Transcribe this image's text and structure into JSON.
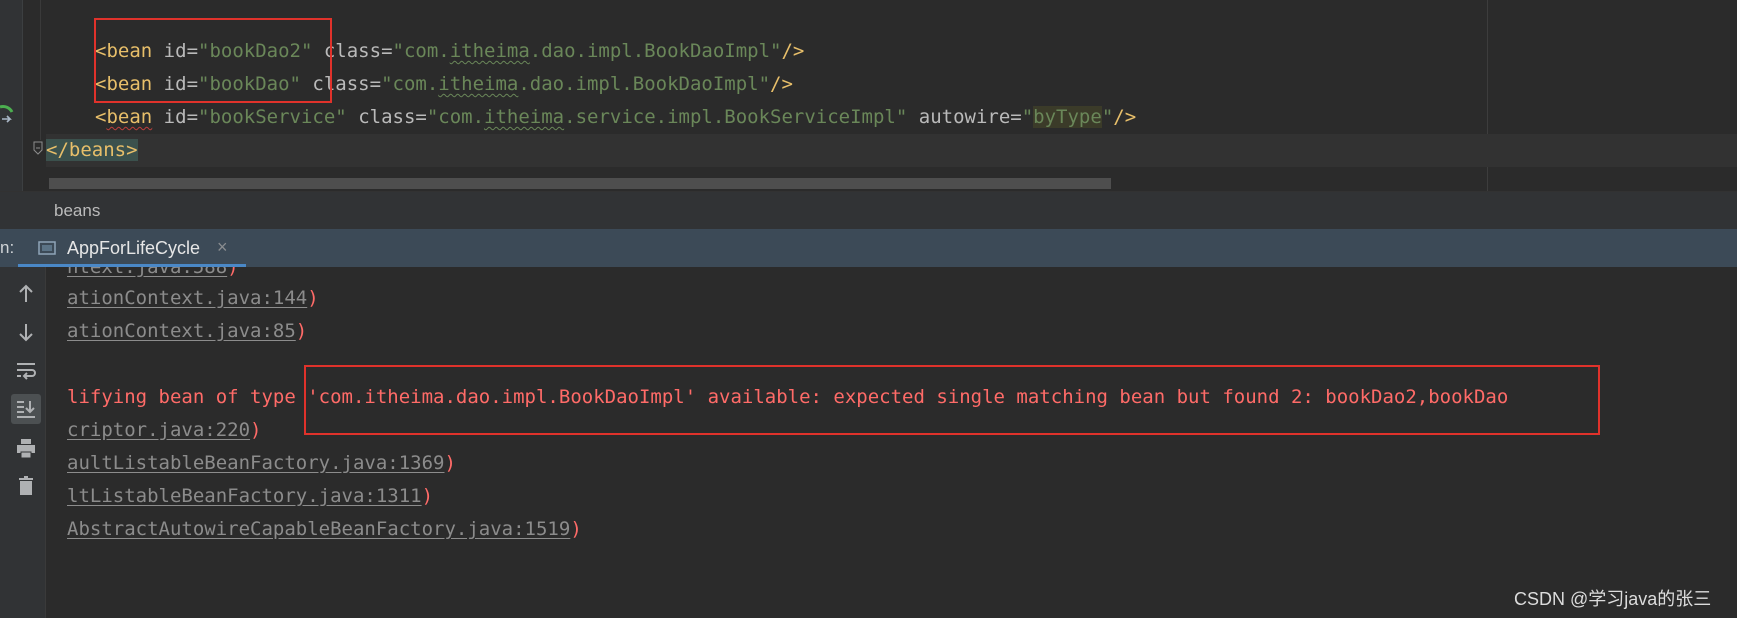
{
  "editor": {
    "lines": [
      {
        "open": "<",
        "tag": "bean",
        "sp1": " ",
        "attr1": "id",
        "eq1": "=",
        "val1": "\"bookDao2\"",
        "sp2": " ",
        "attr2": "class",
        "eq2": "=",
        "val2_a": "\"com.",
        "val2_b": "itheima",
        "val2_c": ".dao.impl.BookDaoImpl\"",
        "close": "/>"
      },
      {
        "open": "<",
        "tag": "bean",
        "sp1": " ",
        "attr1": "id",
        "eq1": "=",
        "val1": "\"bookDao\"",
        "sp2": " ",
        "attr2": "class",
        "eq2": "=",
        "val2_a": "\"com.",
        "val2_b": "itheima",
        "val2_c": ".dao.impl.BookDaoImpl\"",
        "close": "/>"
      },
      {
        "open": "<",
        "tag": "bean",
        "sp1": " ",
        "attr1": "id",
        "eq1": "=",
        "val1": "\"bookService\"",
        "sp2": " ",
        "attr2": "class",
        "eq2": "=",
        "val2_a": "\"com.",
        "val2_b": "itheima",
        "val2_c": ".service.impl.BookServiceImpl\"",
        "sp3": " ",
        "attr3": "autowire",
        "eq3": "=",
        "q_open": "\"",
        "val3": "byType",
        "q_close": "\"",
        "close": "/>"
      }
    ],
    "closing_line": {
      "open": "</",
      "tag": "beans",
      "close": ">"
    }
  },
  "breadcrumb": {
    "text": "beans"
  },
  "run_panel": {
    "label": "n:",
    "tab": {
      "label": "AppForLifeCycle",
      "close": "×"
    }
  },
  "console": {
    "lines": [
      {
        "link": "ntext.java:588",
        "paren": ")"
      },
      {
        "link": "ationContext.java:144",
        "paren": ")"
      },
      {
        "link": "ationContext.java:85",
        "paren": ")"
      },
      {
        "error": "lifying bean of type 'com.itheima.dao.impl.BookDaoImpl' available: expected single matching bean but found 2: bookDao2,bookDao"
      },
      {
        "link": "criptor.java:220",
        "paren": ")"
      },
      {
        "link": "aultListableBeanFactory.java:1369",
        "paren": ")"
      },
      {
        "link": "ltListableBeanFactory.java:1311",
        "paren": ")"
      },
      {
        "link": "AbstractAutowireCapableBeanFactory.java:1519",
        "paren": ")"
      }
    ]
  },
  "toolbar": {
    "buttons": [
      "arrow-up-icon",
      "arrow-down-icon",
      "soft-wrap-icon",
      "scroll-to-end-icon",
      "print-icon",
      "trash-icon"
    ]
  },
  "watermark": {
    "text": "CSDN @学习java的张三"
  },
  "colors": {
    "error_red": "#ff6b68",
    "annotation_red": "#e0322b",
    "xml_tag": "#e8bf6a",
    "xml_value": "#6a8759",
    "tab_underline": "#4a88c7"
  }
}
